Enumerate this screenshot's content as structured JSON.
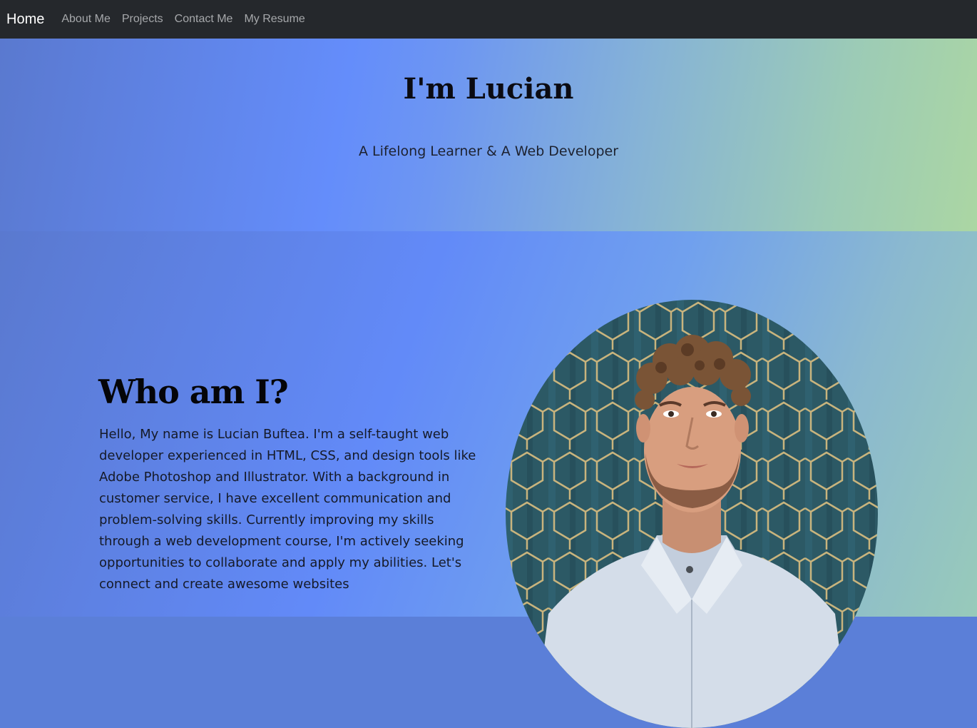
{
  "nav": {
    "brand": "Home",
    "links": [
      "About Me",
      "Projects",
      "Contact Me",
      "My Resume"
    ]
  },
  "hero": {
    "title": "I'm Lucian",
    "subtitle": "A Lifelong Learner & A Web Developer"
  },
  "about": {
    "title": "Who am I?",
    "text": "Hello, My name is Lucian Buftea. I'm a self-taught web developer experienced in HTML, CSS, and design tools like Adobe Photoshop and Illustrator. With a background in customer service, I have excellent communication and problem-solving skills. Currently improving my skills through a web development course, I'm actively seeking opportunities to collaborate and apply my abilities. Let's connect and create awesome websites"
  }
}
